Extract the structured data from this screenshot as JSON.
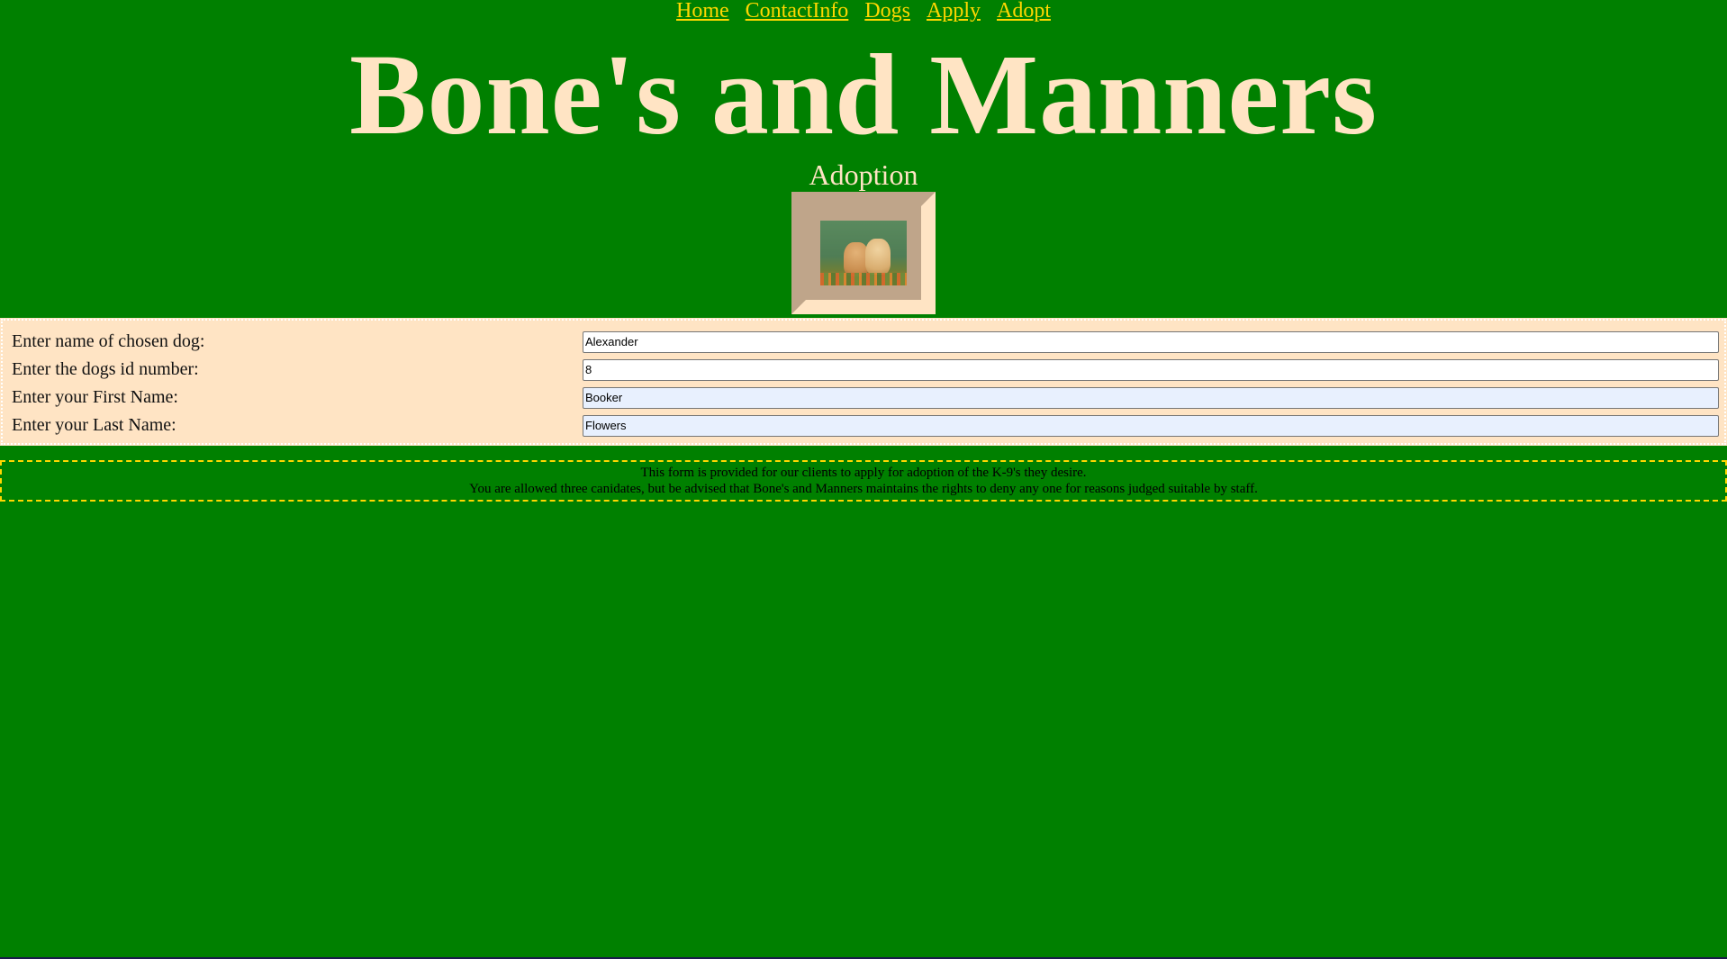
{
  "nav": {
    "items": [
      {
        "label": "Home"
      },
      {
        "label": "ContactInfo"
      },
      {
        "label": "Dogs"
      },
      {
        "label": "Apply"
      },
      {
        "label": "Adopt"
      }
    ]
  },
  "header": {
    "title": "Bone's and Manners",
    "subtitle": "Adoption"
  },
  "image": {
    "description_icon": "dogs-photo"
  },
  "form": {
    "rows": [
      {
        "label": "Enter name of chosen dog:",
        "value": "Alexander"
      },
      {
        "label": "Enter the dogs id number:",
        "value": "8"
      },
      {
        "label": "Enter your First Name:",
        "value": "Booker"
      },
      {
        "label": "Enter your Last Name:",
        "value": "Flowers"
      }
    ]
  },
  "notice": {
    "line1": "This form is provided for our clients to apply for adoption of the K-9's they desire.",
    "line2": "You are allowed three canidates, but be advised that Bone's and Manners maintains the rights to deny any one for reasons judged suitable by staff."
  },
  "colors": {
    "background": "#008000",
    "title": "#ffe4c4",
    "nav_link": "#ffd700",
    "form_bg": "#ffe4c4",
    "notice_border": "#ffd700"
  }
}
